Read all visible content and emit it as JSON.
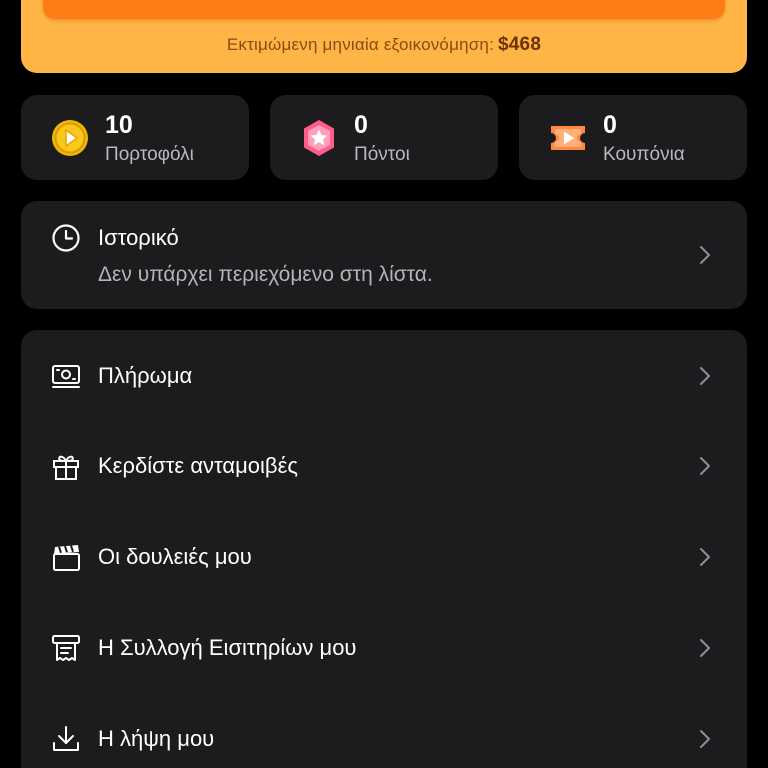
{
  "promo": {
    "savings_label": "Εκτιμώμενη μηνιαία εξοικονόμηση:",
    "savings_amount": "$468",
    "colors": {
      "card": "#ffb545",
      "button": "#ff7b14"
    }
  },
  "stats": [
    {
      "value": "10",
      "label": "Πορτοφόλι",
      "icon": "coin-icon"
    },
    {
      "value": "0",
      "label": "Πόντοι",
      "icon": "star-badge-icon"
    },
    {
      "value": "0",
      "label": "Κουπόνια",
      "icon": "ticket-play-icon"
    }
  ],
  "history": {
    "title": "Ιστορικό",
    "subtitle": "Δεν υπάρχει περιεχόμενο στη λίστα.",
    "icon": "clock-icon"
  },
  "menu": {
    "items": [
      {
        "label": "Πλήρωμα",
        "icon": "cash-icon"
      },
      {
        "label": "Κερδίστε ανταμοιβές",
        "icon": "gift-icon"
      },
      {
        "label": "Οι δουλειές μου",
        "icon": "clapperboard-icon"
      },
      {
        "label": "Η Συλλογή Εισιτηρίων μου",
        "icon": "receipt-icon"
      },
      {
        "label": "Η λήψη μου",
        "icon": "download-icon"
      }
    ]
  },
  "colors": {
    "background": "#000000",
    "card": "#1c1c1e",
    "secondary_text": "#b4b4b8"
  }
}
